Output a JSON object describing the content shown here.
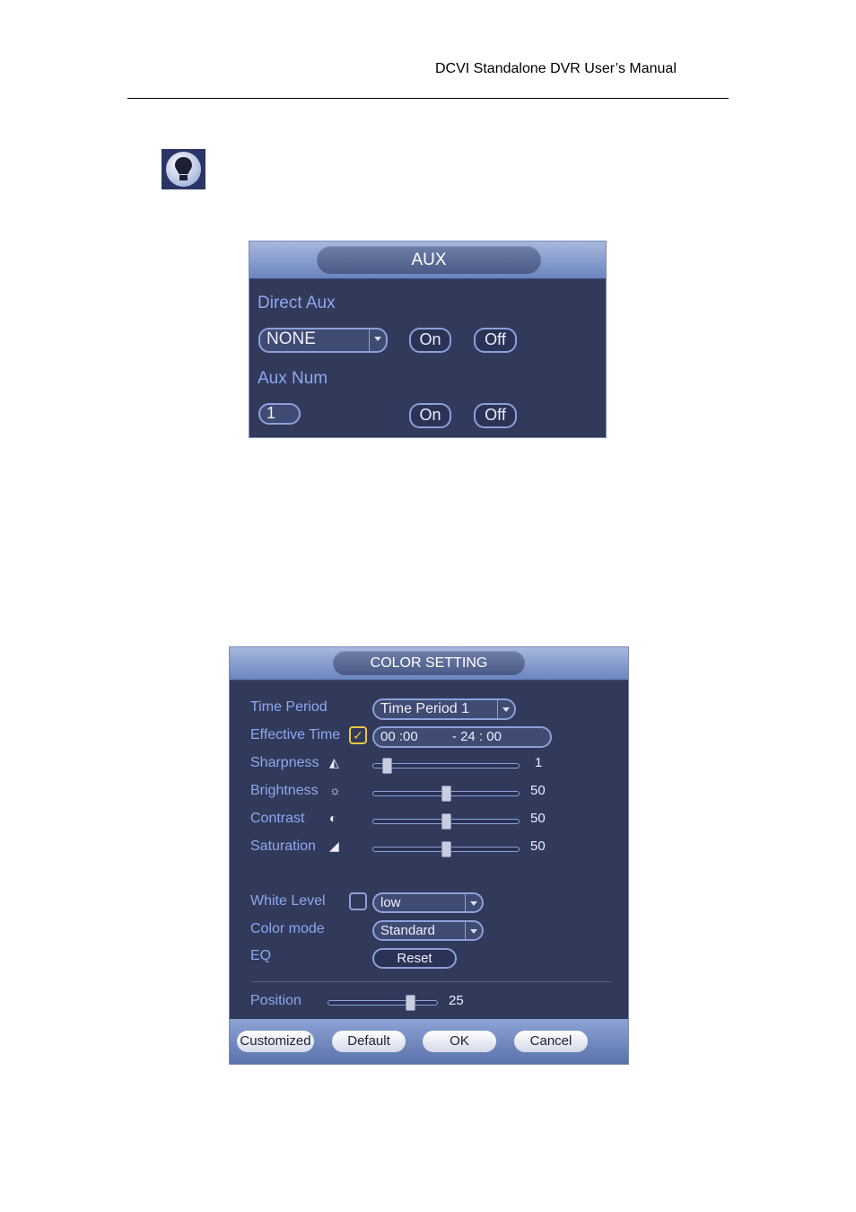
{
  "document_header": "DCVI Standalone DVR User’s Manual",
  "tip_icon": "lightbulb-icon",
  "aux": {
    "title": "AUX",
    "direct_aux_label": "Direct Aux",
    "direct_aux_value": "NONE",
    "on": "On",
    "off": "Off",
    "aux_num_label": "Aux Num",
    "aux_num_value": "1"
  },
  "color": {
    "title": "COLOR SETTING",
    "time_period_label": "Time Period",
    "time_period_value": "Time Period 1",
    "effective_time_label": "Effective Time",
    "effective_time_checked": true,
    "start_hh": "00",
    "start_mm": "00",
    "end_hh": "24",
    "end_mm": "00",
    "sliders": [
      {
        "label": "Sharpness",
        "icon": "sharpness-icon",
        "value": "1"
      },
      {
        "label": "Brightness",
        "icon": "brightness-icon",
        "value": "50"
      },
      {
        "label": "Contrast",
        "icon": "contrast-icon",
        "value": "50"
      },
      {
        "label": "Saturation",
        "icon": "saturation-icon",
        "value": "50"
      }
    ],
    "white_level_label": "White Level",
    "white_level_checked": false,
    "white_level_value": "low",
    "color_mode_label": "Color mode",
    "color_mode_value": "Standard",
    "eq_label": "EQ",
    "reset": "Reset",
    "position_label": "Position",
    "position_value": "25",
    "buttons": {
      "customized": "Customized",
      "default": "Default",
      "ok": "OK",
      "cancel": "Cancel"
    }
  }
}
